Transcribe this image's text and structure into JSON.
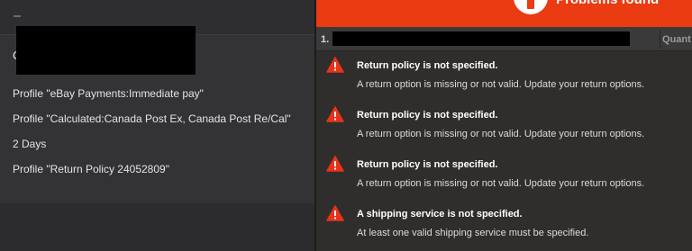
{
  "left": {
    "header_text": "C",
    "lines": [
      "Profile \"eBay Payments:Immediate pay\"",
      "Profile \"Calculated:Canada Post Ex, Canada Post Re/Cal\"",
      "2 Days",
      "Profile \"Return Policy 24052809\""
    ]
  },
  "right": {
    "banner": {
      "text": "Problems found",
      "color": "#ea3b12"
    },
    "column_header": {
      "row_number": "1.",
      "quantity_label": "Quant"
    },
    "errors": [
      {
        "icon": "warning-icon",
        "title": "Return policy is not specified.",
        "message": "A return option is missing or not valid. Update your return options."
      },
      {
        "icon": "warning-icon",
        "title": "Return policy is not specified.",
        "message": "A return option is missing or not valid. Update your return options."
      },
      {
        "icon": "warning-icon",
        "title": "Return policy is not specified.",
        "message": "A return option is missing or not valid. Update your return options."
      },
      {
        "icon": "warning-icon",
        "title": "A shipping service is not specified.",
        "message": "At least one valid shipping service must be specified."
      }
    ]
  }
}
